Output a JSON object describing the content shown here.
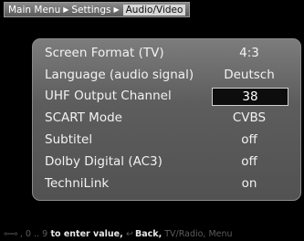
{
  "breadcrumb": {
    "items": [
      "Main Menu",
      "Settings",
      "Audio/Video"
    ]
  },
  "settings": [
    {
      "label": "Screen Format (TV)",
      "value": "4:3"
    },
    {
      "label": "Language (audio signal)",
      "value": "Deutsch"
    },
    {
      "label": "UHF Output Channel",
      "value": "38",
      "selected": true
    },
    {
      "label": "SCART Mode",
      "value": "CVBS"
    },
    {
      "label": "Subtitel",
      "value": "off"
    },
    {
      "label": "Dolby Digital (AC3)",
      "value": "off"
    },
    {
      "label": "TechniLink",
      "value": "on"
    }
  ],
  "footer": {
    "digit_start": "0",
    "digit_end": "9",
    "enter_text": "to enter value,",
    "back_text": "Back,",
    "tvradio_text": "TV/Radio,",
    "menu_text": "Menu"
  }
}
